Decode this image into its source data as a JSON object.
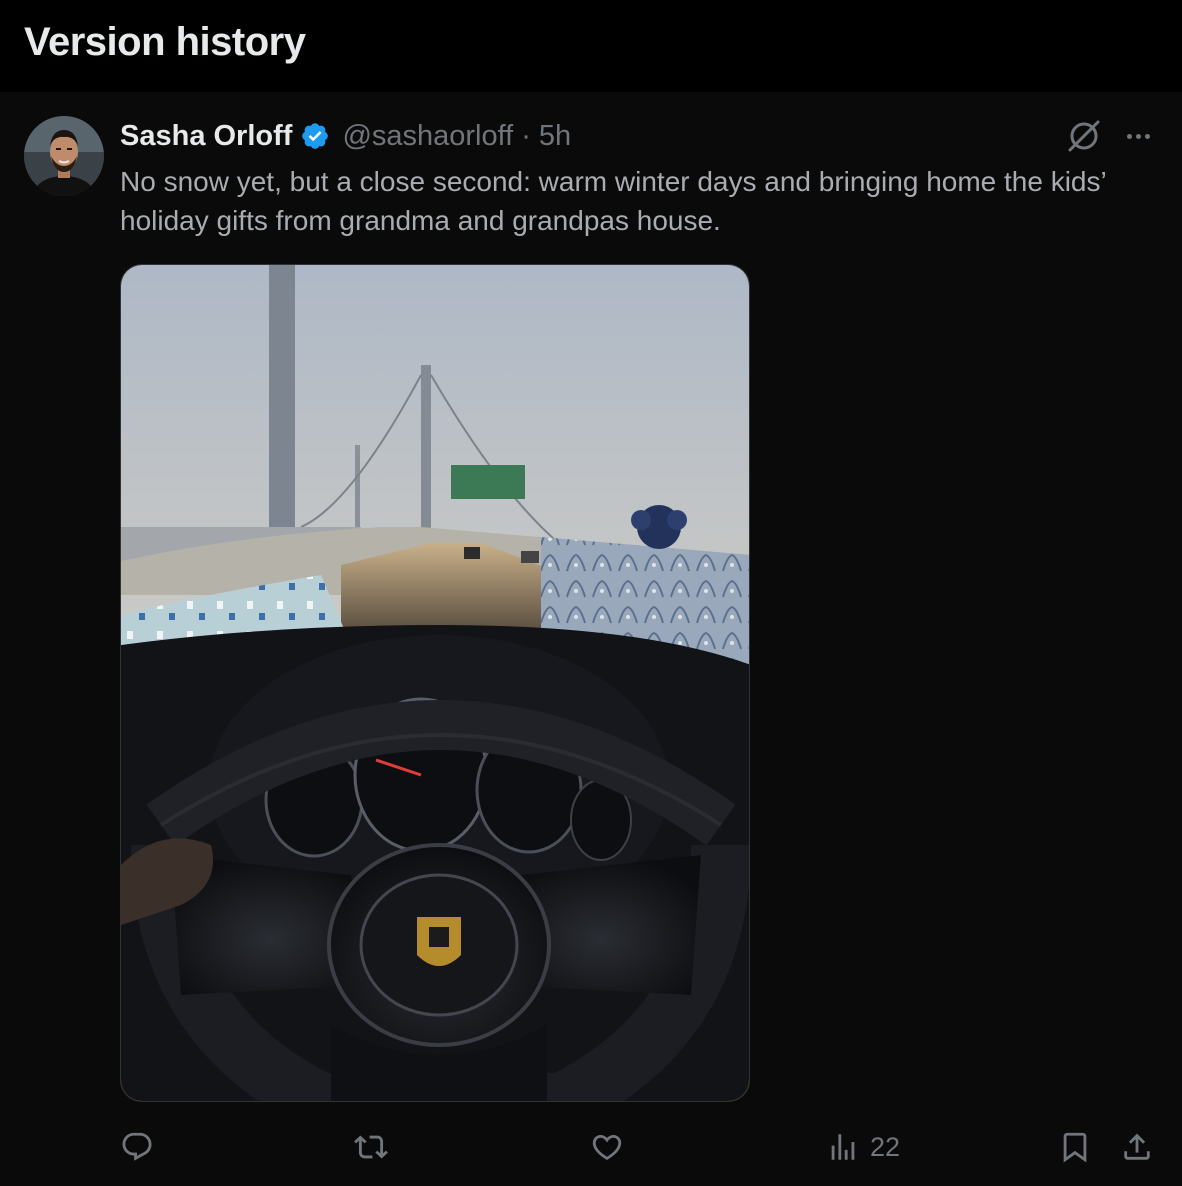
{
  "page": {
    "title": "Version history"
  },
  "post": {
    "author_name": "Sasha Orloff",
    "handle": "@sashaorloff",
    "separator": "·",
    "time": "5h",
    "text": "No snow yet, but a close second: warm winter days and bringing home the kids’ holiday gifts from grandma and grandpas house.",
    "views_count": "22",
    "media_alt": "Porsche steering wheel on a bridge at sunset with wrapped holiday gifts on the dashboard"
  },
  "colors": {
    "background": "#000000",
    "post_background": "#0a0a0a",
    "muted_text": "#71767b",
    "verified_blue": "#1d9bf0"
  },
  "icons": [
    "verified-badge-icon",
    "edit-history-icon",
    "more-icon",
    "reply-icon",
    "repost-icon",
    "like-icon",
    "views-icon",
    "bookmark-icon",
    "share-icon"
  ]
}
